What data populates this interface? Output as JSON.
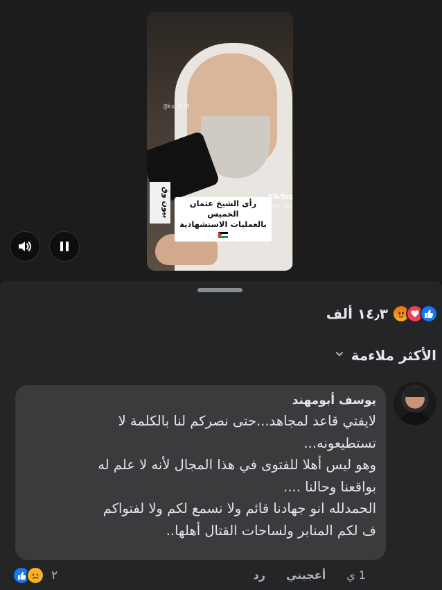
{
  "video": {
    "caption_line1": "رأى الشيخ عثمان الخميس",
    "caption_line2": "بالعمليات الاستشهادية",
    "tiktok_label": "TikTok",
    "handle": "@kx_k10",
    "mic_label": "بيون وق",
    "volume_icon": "speaker-icon",
    "pause_icon": "pause-icon"
  },
  "reactions": {
    "count": "١٤٫٣ ألف",
    "icons": [
      "like-icon",
      "love-icon",
      "angry-icon"
    ],
    "colors": {
      "like": "#1877f2",
      "love": "#f33e58",
      "angry": "#f7b125"
    }
  },
  "sort": {
    "label": "الأكثر ملاءمة",
    "icon": "chevron-down-icon"
  },
  "comment": {
    "author": "يوسف أبومهند",
    "lines": [
      "لايفتي قاعد لمجاهد...حتى نصركم لنا بالكلمة لا",
      "تستطيعونه...",
      "وهو ليس أهلا للفتوى في هذا المجال لأنه لا علم له",
      "بواقعنا وحالنا ....",
      "الحمدلله انو جهادنا قائم ولا نسمع لكم ولا لفتواكم",
      "ف لكم المنابر ولساحات القتال أهلها.."
    ],
    "time": "1 ي",
    "like_label": "أعجبني",
    "reply_label": "رد",
    "reaction_count": "٢",
    "reaction_icons": [
      "like-icon",
      "sad-icon"
    ]
  },
  "colors": {
    "background": "#18191a",
    "sheet": "#242526",
    "bubble": "#3a3b3c",
    "text": "#e4e6eb",
    "muted": "#b0b3b8",
    "accent": "#1877f2"
  }
}
